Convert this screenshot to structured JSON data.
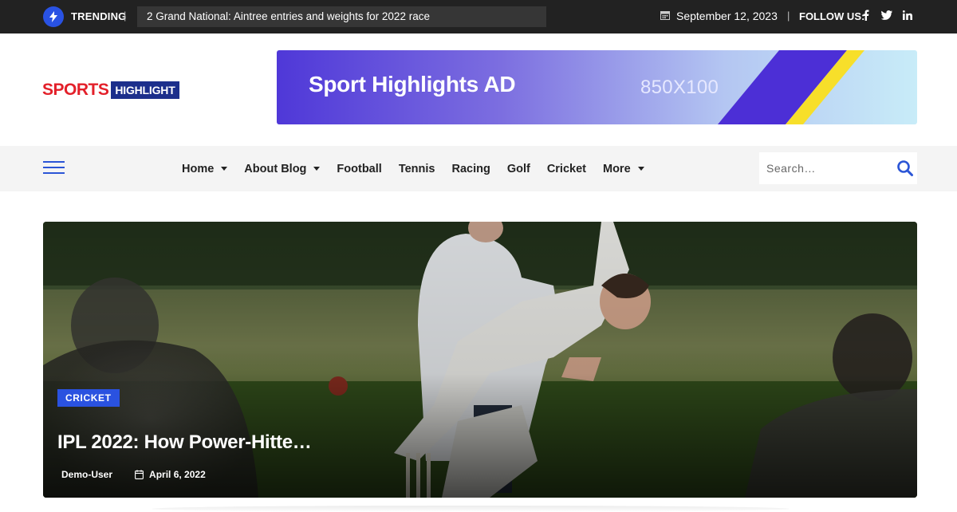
{
  "topbar": {
    "trending_label": "TRENDING",
    "trending_separator": "|",
    "ticker_text": "2 Grand National: Aintree entries and weights for 2022 race",
    "date": "September 12, 2023",
    "follow_separator": "|",
    "follow_label": "FOLLOW US:",
    "socials": [
      "facebook-icon",
      "twitter-icon",
      "linkedin-icon"
    ]
  },
  "header": {
    "logo_part1": "SPORTS",
    "logo_part2": "HIGHLIGHT",
    "ad_title": "Sport Highlights AD",
    "ad_size": "850X100"
  },
  "nav": {
    "items": [
      {
        "label": "Home",
        "dropdown": true
      },
      {
        "label": "About Blog",
        "dropdown": true
      },
      {
        "label": "Football",
        "dropdown": false
      },
      {
        "label": "Tennis",
        "dropdown": false
      },
      {
        "label": "Racing",
        "dropdown": false
      },
      {
        "label": "Golf",
        "dropdown": false
      },
      {
        "label": "Cricket",
        "dropdown": false
      },
      {
        "label": "More",
        "dropdown": true
      }
    ],
    "search_placeholder": "Search…"
  },
  "hero": {
    "category": "CRICKET",
    "title": "IPL 2022: How Power-Hitte…",
    "author": "Demo-User",
    "date": "April 6, 2022"
  },
  "colors": {
    "accent": "#2a52e0",
    "topbar_bg": "#222222",
    "logo_red": "#e3202a",
    "logo_blue": "#1c2f8c"
  }
}
